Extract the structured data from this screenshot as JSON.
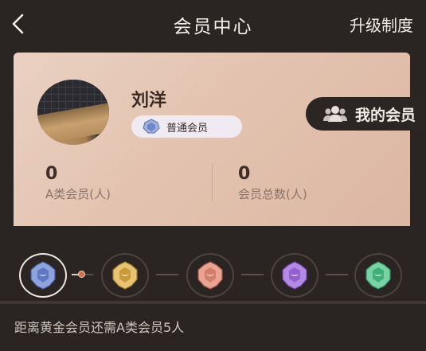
{
  "header": {
    "title": "会员中心",
    "upgrade_label": "升级制度"
  },
  "profile": {
    "name": "刘洋",
    "level_label": "普通会员"
  },
  "stats": {
    "a_members_value": "0",
    "a_members_label": "A类会员(人)",
    "total_members_value": "0",
    "total_members_label": "会员总数(人)"
  },
  "my_members": {
    "label": "我的会员",
    "icon": "people-icon"
  },
  "levels": [
    {
      "key": "normal",
      "color": "#6f86c8",
      "current": true
    },
    {
      "key": "gold",
      "color": "#d6a64a"
    },
    {
      "key": "rose",
      "color": "#d88a79"
    },
    {
      "key": "purple",
      "color": "#9b6bd1"
    },
    {
      "key": "green",
      "color": "#4bb982"
    }
  ],
  "hint": "距离黄金会员还需A类会员5人"
}
